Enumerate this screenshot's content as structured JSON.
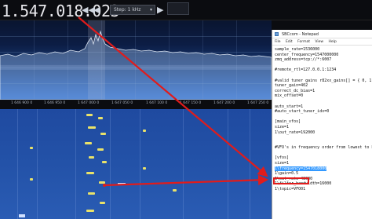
{
  "sdr": {
    "frequency": "1.547.018.023",
    "step_label": "Step: 1 kHz",
    "axis_ticks": [
      "1 646 900 0",
      "1 646 950 0",
      "1 647 000 0",
      "1 647 050 0",
      "1 647 100 0",
      "1 647 150 0",
      "1 647 200 0",
      "1 647 250 0"
    ],
    "nav_buttons": {
      "rewind": "◀◀",
      "prev": "◀",
      "next": "▶",
      "forward": "▶▶"
    }
  },
  "notepad": {
    "title": "SBCcom - Notepad",
    "menu": [
      "File",
      "Edit",
      "Format",
      "View",
      "Help"
    ],
    "lines": [
      "sample_rate=1536000",
      "center_frequency=1547000000",
      "zmq_address=tcp://*:6007",
      "",
      "#remote_rtl=127.0.0.1:1234",
      "",
      "#valid tuner gains r82xx_gains[] = { 0, 1",
      "tuner_gain=402",
      "correct_dc_bias=1",
      "mix_offset=0",
      "",
      "auto_start=1",
      "#auto_start_tuner_idx=0",
      "",
      "[main_vfos]",
      "size=1",
      "1\\out_rate=192000",
      "",
      "",
      "#VFO's in frequency order from lowest to hig",
      "",
      "[vfos]",
      "size=1",
      "1\\frequency=1547018000",
      "1\\gain=0.5",
      "1\\out_rate=48000",
      "1\\filter_bandwidth=16000",
      "1\\topic=VFO01"
    ],
    "selected_line_index": 23
  },
  "colors": {
    "annotation_red": "#e01c1c",
    "selection_blue": "#3399ff",
    "signal_yellow": "#e9e26a"
  }
}
